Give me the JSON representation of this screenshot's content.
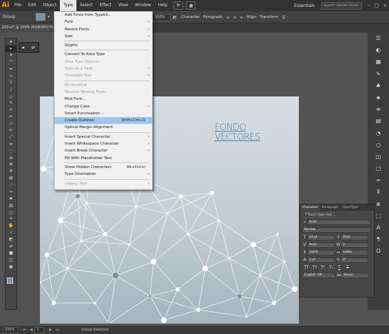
{
  "app": {
    "logo": "Ai",
    "menus": [
      "File",
      "Edit",
      "Object",
      "Type",
      "Select",
      "Effect",
      "View",
      "Window",
      "Help"
    ],
    "active_menu": "Type",
    "workspace": "Essentials",
    "search_placeholder": "Search Adobe Stock"
  },
  "control_bar": {
    "selection_label": "Group",
    "opacity_value": "100%",
    "links": [
      "Character",
      "Paragraph",
      "Align",
      "Transform"
    ]
  },
  "document": {
    "tab_title": "220.ai* @ 100% (RGB/GPU Pr..."
  },
  "type_menu": {
    "items": [
      {
        "label": "Add Fonts from Typekit...",
        "disabled": false,
        "shortcut": "",
        "submenu": false
      },
      {
        "label": "Font",
        "disabled": false,
        "shortcut": "",
        "submenu": true
      },
      {
        "label": "Recent Fonts",
        "disabled": false,
        "shortcut": "",
        "submenu": true
      },
      {
        "label": "Size",
        "disabled": false,
        "shortcut": "",
        "submenu": true
      },
      {
        "sep": true
      },
      {
        "label": "Glyphs",
        "disabled": false,
        "shortcut": "",
        "submenu": false
      },
      {
        "sep": true
      },
      {
        "label": "Convert To Area Type",
        "disabled": false,
        "shortcut": "",
        "submenu": false
      },
      {
        "label": "Area Type Options...",
        "disabled": true,
        "shortcut": "",
        "submenu": false
      },
      {
        "label": "Type on a Path",
        "disabled": true,
        "shortcut": "",
        "submenu": true
      },
      {
        "label": "Threaded Text",
        "disabled": true,
        "shortcut": "",
        "submenu": true
      },
      {
        "sep": true
      },
      {
        "label": "Fit Headline",
        "disabled": true,
        "shortcut": "",
        "submenu": false
      },
      {
        "label": "Resolve Missing Fonts...",
        "disabled": true,
        "shortcut": "",
        "submenu": false
      },
      {
        "label": "Find Font...",
        "disabled": false,
        "shortcut": "",
        "submenu": false
      },
      {
        "label": "Change Case",
        "disabled": false,
        "shortcut": "",
        "submenu": true
      },
      {
        "label": "Smart Punctuation...",
        "disabled": false,
        "shortcut": "",
        "submenu": false
      },
      {
        "label": "Create Outlines",
        "disabled": false,
        "shortcut": "Shift+Ctrl+O",
        "submenu": false,
        "highlighted": true
      },
      {
        "label": "Optical Margin Alignment",
        "disabled": false,
        "shortcut": "",
        "submenu": false
      },
      {
        "sep": true
      },
      {
        "label": "Insert Special Character",
        "disabled": false,
        "shortcut": "",
        "submenu": true
      },
      {
        "label": "Insert Whitespace Character",
        "disabled": false,
        "shortcut": "",
        "submenu": true
      },
      {
        "label": "Insert Break Character",
        "disabled": false,
        "shortcut": "",
        "submenu": true
      },
      {
        "label": "Fill With Placeholder Text",
        "disabled": false,
        "shortcut": "",
        "submenu": false
      },
      {
        "sep": true
      },
      {
        "label": "Show Hidden Characters",
        "disabled": false,
        "shortcut": "Alt+Ctrl+I",
        "submenu": false
      },
      {
        "label": "Type Orientation",
        "disabled": false,
        "shortcut": "",
        "submenu": true
      },
      {
        "sep": true
      },
      {
        "label": "Legacy Text",
        "disabled": true,
        "shortcut": "",
        "submenu": true
      }
    ]
  },
  "artboard": {
    "title_line1": "FONDO",
    "title_line2": "VECTORES"
  },
  "character_panel": {
    "tabs": [
      "Character",
      "Paragraph",
      "OpenType"
    ],
    "touch_type_label": "Touch Type Tool",
    "font_family": "Arial",
    "font_style": "Narrow",
    "font_size": "12 pt",
    "leading": "Auto",
    "tracking": "0",
    "kerning": "Auto",
    "vertical_scale": "100%",
    "horizontal_scale": "100%",
    "baseline_shift": "0 pt",
    "rotation": "0°",
    "language": "English: UK",
    "anti_alias": "Sharp"
  },
  "status_bar": {
    "zoom": "100%",
    "page": "1",
    "tool": "Group Selection"
  },
  "colors": {
    "menubar_bg": "#323232",
    "highlight": "#9ec6ee",
    "logo": "#ff9a00",
    "title_text": "#5a7a96"
  }
}
